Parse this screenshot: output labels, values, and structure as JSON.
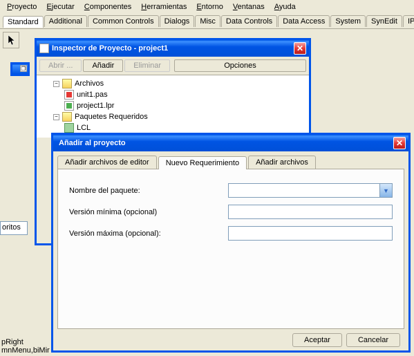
{
  "menu": [
    "Proyecto",
    "Ejecutar",
    "Componentes",
    "Herramientas",
    "Entorno",
    "Ventanas",
    "Ayuda"
  ],
  "paletteTabs": [
    "Standard",
    "Additional",
    "Common Controls",
    "Dialogs",
    "Misc",
    "Data Controls",
    "Data Access",
    "System",
    "SynEdit",
    "IPro"
  ],
  "inspector": {
    "title": "Inspector de Proyecto - project1",
    "buttons": {
      "open": "Abrir ...",
      "add": "Añadir",
      "remove": "Eliminar",
      "options": "Opciones"
    },
    "tree": {
      "files": "Archivos",
      "unit": "unit1.pas",
      "lpr": "project1.lpr",
      "required": "Paquetes Requeridos",
      "lcl": "LCL"
    }
  },
  "addDialog": {
    "title": "Añadir al proyecto",
    "tabs": {
      "editor": "Añadir archivos de editor",
      "newreq": "Nuevo Requerimiento",
      "addfiles": "Añadir archivos"
    },
    "fields": {
      "pkgName": "Nombre del paquete:",
      "minVer": "Versión mínima (opcional)",
      "maxVer": "Versión máxima (opcional):"
    },
    "values": {
      "pkgName": "",
      "minVer": "",
      "maxVer": ""
    },
    "ok": "Aceptar",
    "cancel": "Cancelar"
  },
  "leftFragments": {
    "oritos": "oritos",
    "pRight": "pRight",
    "mnMenu": "mnMenu,biMir"
  }
}
